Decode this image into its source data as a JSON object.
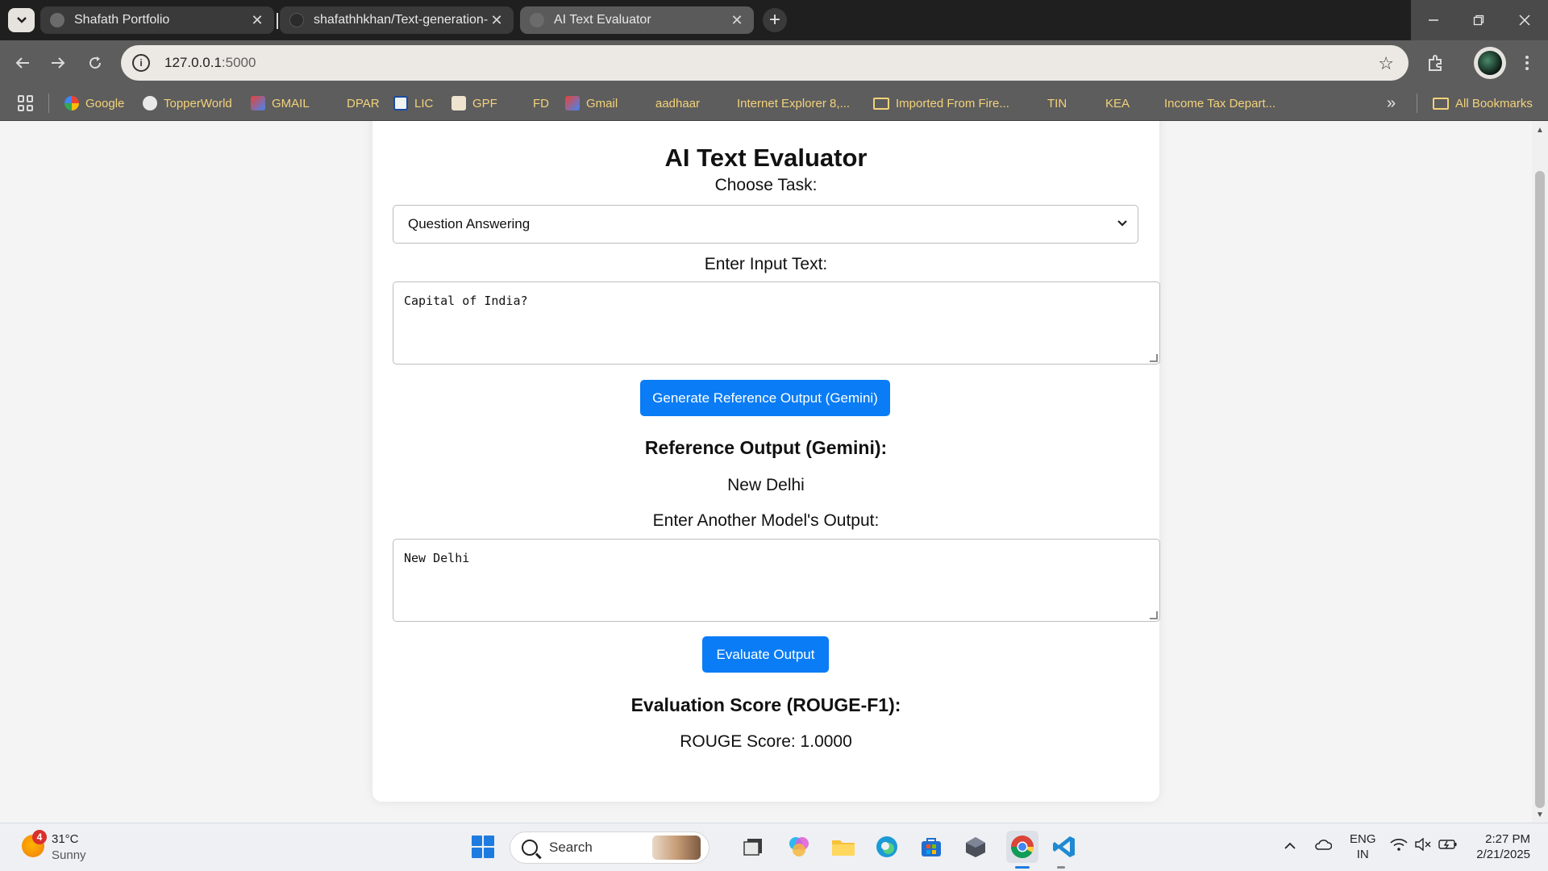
{
  "browser": {
    "tabs": [
      {
        "title": "Shafath Portfolio"
      },
      {
        "title": "shafathhkhan/Text-generation-"
      },
      {
        "title": "AI Text Evaluator"
      }
    ],
    "url_host": "127.0.0.1",
    "url_port": ":5000",
    "bookmarks": [
      {
        "label": "Google"
      },
      {
        "label": "TopperWorld"
      },
      {
        "label": "GMAIL"
      },
      {
        "label": "DPAR"
      },
      {
        "label": "LIC"
      },
      {
        "label": "GPF"
      },
      {
        "label": "FD"
      },
      {
        "label": "Gmail"
      },
      {
        "label": "aadhaar"
      },
      {
        "label": "Internet Explorer 8,..."
      },
      {
        "label": "Imported From Fire..."
      },
      {
        "label": "TIN"
      },
      {
        "label": "KEA"
      },
      {
        "label": "Income Tax Depart..."
      }
    ],
    "all_bookmarks": "All Bookmarks",
    "more_bookmarks": "»"
  },
  "page": {
    "title": "AI Text Evaluator",
    "task_label": "Choose Task:",
    "task_selected": "Question Answering",
    "input_label": "Enter Input Text:",
    "input_value": "Capital of India?",
    "generate_button": "Generate Reference Output (Gemini)",
    "reference_heading": "Reference Output (Gemini):",
    "reference_value": "New Delhi",
    "model_output_label": "Enter Another Model's Output:",
    "model_output_value": "New Delhi",
    "evaluate_button": "Evaluate Output",
    "score_heading": "Evaluation Score (ROUGE-F1):",
    "score_value": "ROUGE Score: 1.0000"
  },
  "taskbar": {
    "weather_badge": "4",
    "temperature": "31°C",
    "condition": "Sunny",
    "search_placeholder": "Search",
    "lang_primary": "ENG",
    "lang_secondary": "IN",
    "time": "2:27 PM",
    "date": "2/21/2025"
  },
  "colors": {
    "accent_button": "#0a7cf5",
    "bookmark_text": "#f3d27a",
    "tab_strip": "#1f1f1f"
  }
}
